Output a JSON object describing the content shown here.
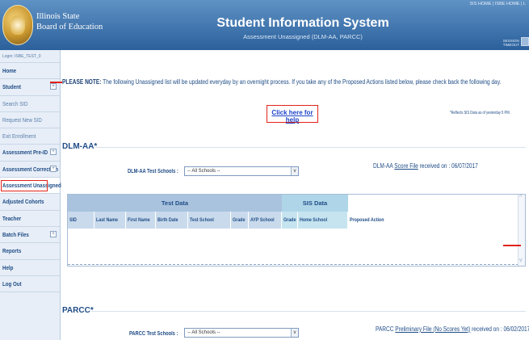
{
  "header": {
    "agency_line1": "Illinois State",
    "agency_line2": "Board of Education",
    "title": "Student Information System",
    "subtitle": "Assessment Unassigned (DLM-AA, PARCC)",
    "top_links": "SIS HOME  |  ISBE HOME  |  L",
    "session_line1": "SESSION",
    "session_line2": "TIMEOUT"
  },
  "sidebar": {
    "login": "Login: ISBE_TEST_0",
    "items": [
      {
        "label": "Home",
        "expandable": false,
        "style": "main"
      },
      {
        "label": "Student",
        "expandable": true,
        "style": "main"
      },
      {
        "label": "Search SID",
        "expandable": false,
        "style": "sub"
      },
      {
        "label": "Request New SID",
        "expandable": false,
        "style": "sub"
      },
      {
        "label": "Exit Enrollment",
        "expandable": false,
        "style": "sub"
      },
      {
        "label": "Assessment Pre-ID",
        "expandable": true,
        "style": "main"
      },
      {
        "label": "Assessment Correction",
        "expandable": true,
        "style": "main"
      },
      {
        "label": "Assessment Unassigned",
        "expandable": false,
        "style": "main",
        "active": true
      },
      {
        "label": "Adjusted Cohorts",
        "expandable": false,
        "style": "main"
      },
      {
        "label": "Teacher",
        "expandable": false,
        "style": "main"
      },
      {
        "label": "Batch Files",
        "expandable": true,
        "style": "main"
      },
      {
        "label": "Reports",
        "expandable": false,
        "style": "main"
      },
      {
        "label": "Help",
        "expandable": false,
        "style": "main"
      },
      {
        "label": "Log Out",
        "expandable": false,
        "style": "main"
      }
    ],
    "plus_glyph": "+"
  },
  "notice": {
    "label": "PLEASE NOTE:",
    "text": " The following Unassigned list will be updated everyday by an overnight process.  If you take any of the Proposed Actions listed below, please check back the following day."
  },
  "help_link": "Click here for help",
  "reflects_note": "*Reflects SIS Data as of yesterday 5 PM.",
  "dlm": {
    "title": "DLM-AA*",
    "filter_label": "DLM-AA Test Schools :",
    "filter_value": "-- All Schools --",
    "file_prefix": "DLM-AA ",
    "file_link": "Score File",
    "file_suffix": " received on : 06/07/2017"
  },
  "table": {
    "group_test": "Test Data",
    "group_sis": "SIS Data",
    "columns": [
      "SID",
      "Last Name",
      "First Name",
      "Birth Date",
      "Test School",
      "Grade",
      "AYP School",
      "Grade",
      "Home School",
      "Proposed Action"
    ]
  },
  "parcc": {
    "title": "PARCC*",
    "filter_label": "PARCC Test Schools :",
    "filter_value": "-- All Schools --",
    "file_prefix": "PARCC ",
    "file_link": "Preliminary File (No Scores Yet)",
    "file_suffix": " received on : 06/02/2017"
  },
  "icons": {
    "dropdown_arrow": "v",
    "scroll_up": "^",
    "scroll_down": "v"
  },
  "colors": {
    "header_top": "#5f92c4",
    "header_bottom": "#2b609c",
    "test_data_header": "#a9c3de",
    "sis_data_header": "#aed6e8",
    "highlight_red": "#e0231a",
    "link_blue": "#1c43c9"
  }
}
